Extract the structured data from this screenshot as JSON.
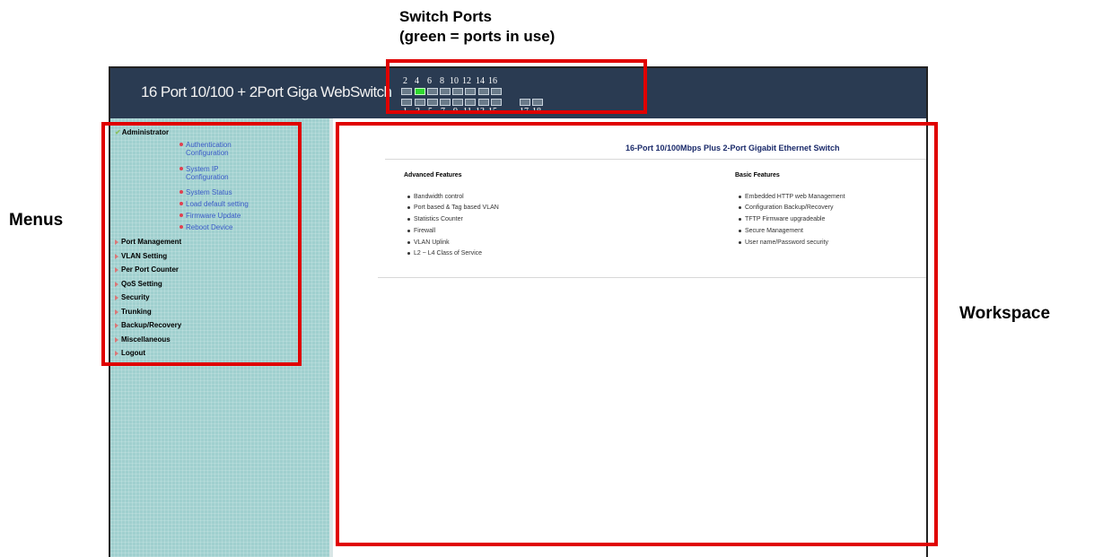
{
  "annotations": {
    "switch_ports_line1": "Switch Ports",
    "switch_ports_line2": "(green = ports in use)",
    "menus": "Menus",
    "workspace": "Workspace"
  },
  "header": {
    "title": "16 Port 10/100 + 2Port Giga WebSwitch"
  },
  "ports": {
    "top_numbers": [
      "2",
      "4",
      "6",
      "8",
      "10",
      "12",
      "14",
      "16"
    ],
    "bottom_numbers": [
      "1",
      "3",
      "5",
      "7",
      "9",
      "11",
      "13",
      "15",
      "17",
      "18"
    ],
    "active_port": "4",
    "active_color": "#2ed82e"
  },
  "sidebar": {
    "administrator": {
      "label": "Administrator",
      "items": [
        {
          "line1": "Authentication",
          "line2": "Configuration"
        },
        {
          "line1": "System IP",
          "line2": "Configuration"
        },
        {
          "line1": "System Status"
        },
        {
          "line1": "Load default setting"
        },
        {
          "line1": "Firmware Update"
        },
        {
          "line1": "Reboot Device"
        }
      ]
    },
    "menus": [
      "Port Management",
      "VLAN Setting",
      "Per Port Counter",
      "QoS Setting",
      "Security",
      "Trunking",
      "Backup/Recovery",
      "Miscellaneous",
      "Logout"
    ]
  },
  "workspace": {
    "title": "16-Port 10/100Mbps Plus 2-Port Gigabit Ethernet Switch",
    "advanced": {
      "heading": "Advanced Features",
      "items": [
        "Bandwidth control",
        "Port based & Tag based VLAN",
        "Statistics Counter",
        "Firewall",
        "VLAN Uplink",
        "L2 ~ L4 Class of Service"
      ]
    },
    "basic": {
      "heading": "Basic Features",
      "items": [
        "Embedded HTTP web Management",
        "Configuration Backup/Recovery",
        "TFTP Firmware upgradeable",
        "Secure Management",
        "User name/Password security"
      ]
    }
  },
  "colors": {
    "header_bg": "#2a3b52",
    "sidebar_bg": "#a0d0cf",
    "annotation_red": "#e00000",
    "link_blue": "#3a5ac8"
  }
}
